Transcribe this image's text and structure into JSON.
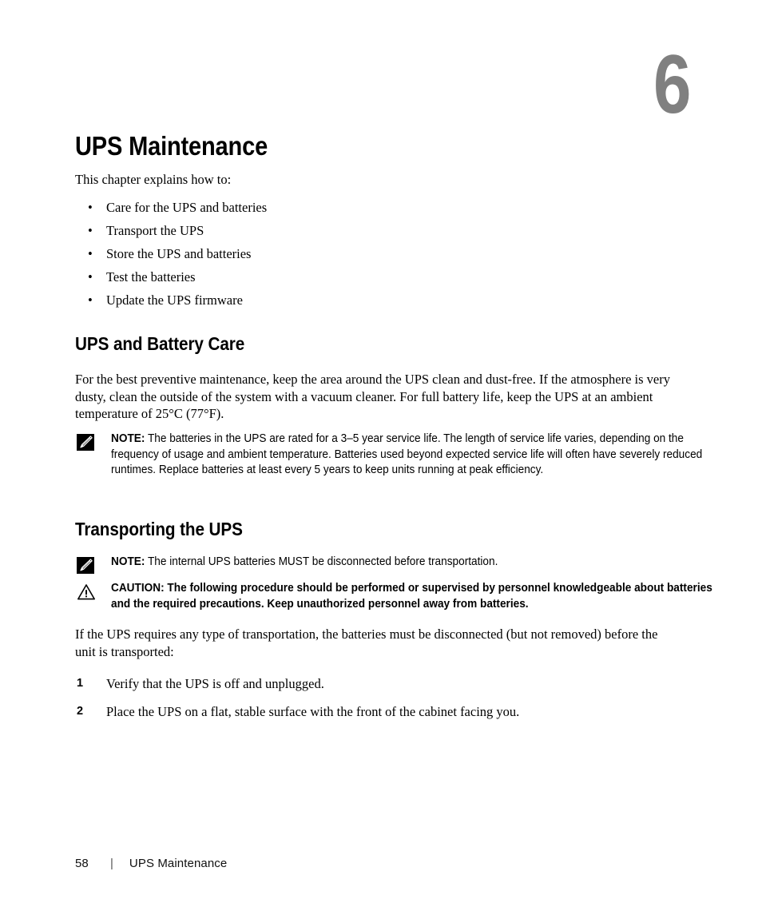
{
  "chapter": {
    "number": "6",
    "title": "UPS Maintenance",
    "intro": "This chapter explains how to:",
    "bullets": [
      "Care for the UPS and batteries",
      "Transport the UPS",
      "Store the UPS and batteries",
      "Test the batteries",
      "Update the UPS firmware"
    ],
    "bullet_glyph": "•"
  },
  "sections": {
    "battery_care": {
      "heading": "UPS and Battery Care",
      "paragraph": "For the best preventive maintenance, keep the area around the UPS clean and dust-free. If the atmosphere is very dusty, clean the outside of the system with a vacuum cleaner. For full battery life, keep the UPS at an ambient temperature of 25°C (77°F).",
      "note": {
        "label": "NOTE:",
        "text": " The batteries in the UPS are rated for a 3–5 year service life. The length of service life varies, depending on the frequency of usage and ambient temperature. Batteries used beyond expected service life will often have severely reduced runtimes. Replace batteries at least every 5 years to keep units running at peak efficiency."
      }
    },
    "transporting": {
      "heading": "Transporting the UPS",
      "note": {
        "label": "NOTE:",
        "text": " The internal UPS batteries MUST be disconnected before transportation."
      },
      "caution": {
        "label": "CAUTION:",
        "text": " The following procedure should be performed or supervised by personnel knowledgeable about batteries and the required precautions. Keep unauthorized personnel away from batteries."
      },
      "paragraph": "If the UPS requires any type of transportation, the batteries must be disconnected (but not removed) before the unit is transported:",
      "steps": [
        {
          "number": "1",
          "text": "Verify that the UPS is off and unplugged."
        },
        {
          "number": "2",
          "text": "Place the UPS on a flat, stable surface with the front of the cabinet facing you."
        }
      ]
    }
  },
  "footer": {
    "page_number": "58",
    "separator": "|",
    "title": "UPS Maintenance"
  },
  "colors": {
    "chapter_number": "#808080",
    "text": "#000000",
    "page_background": "#ffffff"
  },
  "icons": {
    "note": "note-pencil-icon",
    "caution": "caution-triangle-icon"
  }
}
